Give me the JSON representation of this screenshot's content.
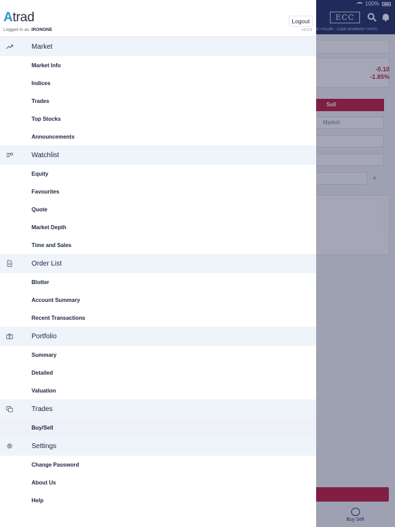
{
  "status": {
    "battery": "100%"
  },
  "background": {
    "logo_text": "ECC",
    "ticker": "d  •  AUJM - Cash Dividend  •  nAYC",
    "change_value": "-0.10",
    "change_pct": "-1.85%",
    "sell_label": "Sell",
    "order_type_placeholder": "Market",
    "plus": "+",
    "dash": "-",
    "tab_label": "Buy Sell"
  },
  "drawer": {
    "logo": {
      "mark": "A",
      "rest": "trad"
    },
    "logged_in_prefix": "Logged in as: ",
    "username": "IRONONE",
    "logout_label": "Logout",
    "version": "v2.0.0",
    "sections": [
      {
        "label": "Market",
        "icon": "trend-up-icon",
        "items": [
          "Market Info",
          "Indices",
          "Trades",
          "Top Stocks",
          "Announcements"
        ]
      },
      {
        "label": "Watchlist",
        "icon": "watchlist-icon",
        "items": [
          "Equity",
          "Favourites",
          "Quote",
          "Market Depth",
          "Time and Sales"
        ]
      },
      {
        "label": "Order List",
        "icon": "document-icon",
        "items": [
          "Blotter",
          "Account Summary",
          "Recent Transactions"
        ]
      },
      {
        "label": "Portfolio",
        "icon": "briefcase-icon",
        "items": [
          "Summary",
          "Detailed",
          "Valuation"
        ]
      },
      {
        "label": "Trades",
        "icon": "trades-icon",
        "items": [
          "Buy/Sell"
        ],
        "active_item": 0
      },
      {
        "label": "Settings",
        "icon": "gear-icon",
        "items": [
          "Change Password",
          "About Us",
          "Help"
        ]
      }
    ]
  }
}
